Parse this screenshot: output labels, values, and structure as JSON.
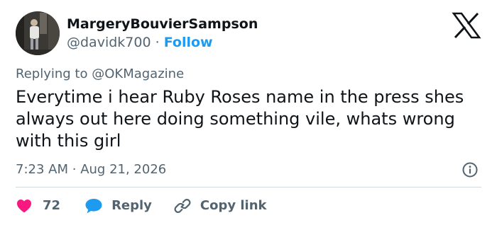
{
  "author": {
    "display_name": "MargeryBouvierSampson",
    "handle": "@davidk700",
    "separator": "·",
    "follow_label": "Follow"
  },
  "reply_context": {
    "prefix": "Replying to",
    "mention": "@OKMagazine"
  },
  "tweet": {
    "text": "Everytime i hear Ruby Roses name in the press shes always out here doing something vile, whats wrong with this girl",
    "time": "7:23 AM",
    "separator": "·",
    "date": "Aug 21, 2026"
  },
  "actions": {
    "like_count": "72",
    "reply_label": "Reply",
    "copy_link_label": "Copy link"
  },
  "icons": {
    "logo": "x-logo-icon",
    "info": "info-icon",
    "like": "heart-icon",
    "reply": "speech-bubble-icon",
    "copy": "link-icon"
  },
  "colors": {
    "text": "#0f1419",
    "secondary": "#536471",
    "link": "#1d9bf0",
    "like": "#f91880",
    "divider": "#cfd9de"
  }
}
